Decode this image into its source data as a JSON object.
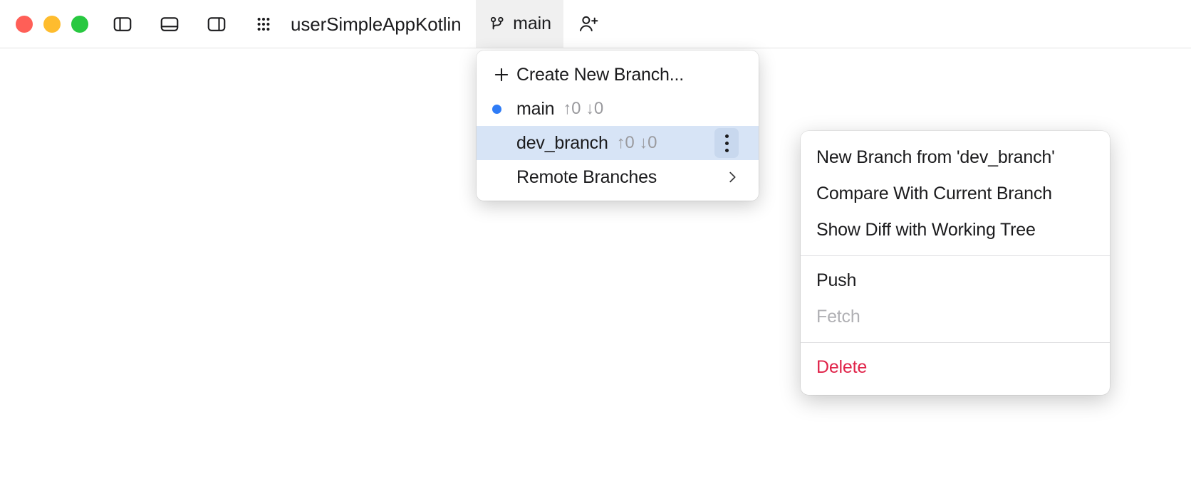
{
  "window": {
    "title": "userSimpleAppKotlin",
    "traffic_lights": [
      {
        "name": "close",
        "color": "#ff5f57"
      },
      {
        "name": "minimize",
        "color": "#febc2e"
      },
      {
        "name": "maximize",
        "color": "#28c840"
      }
    ],
    "toolbar_icons": [
      {
        "name": "left-panel-toggle-icon",
        "label": "Toggle Left Panel"
      },
      {
        "name": "bottom-panel-toggle-icon",
        "label": "Toggle Bottom Panel"
      },
      {
        "name": "right-panel-toggle-icon",
        "label": "Toggle Right Panel"
      },
      {
        "name": "grid-apps-icon",
        "label": "All Tools"
      }
    ],
    "branch_button": {
      "label": "main",
      "icon": "git-branch-icon",
      "active_background": "#f0f0f0"
    },
    "add_person_button": {
      "icon": "person-add-icon",
      "label": "Invite Collaborator"
    }
  },
  "branch_dropdown": {
    "items": [
      {
        "id": "create-new-branch",
        "label": "Create New Branch...",
        "icon": "plus-icon",
        "type": "action"
      },
      {
        "id": "main",
        "label": "main",
        "ahead": "↑0",
        "behind": "↓0",
        "type": "branch",
        "current": true,
        "bullet_color": "#2f7cf6"
      },
      {
        "id": "dev_branch",
        "label": "dev_branch",
        "ahead": "↑0",
        "behind": "↓0",
        "type": "branch",
        "current": false,
        "selected": true,
        "highlight_color": "#d7e4f6",
        "kebab_icon": "more-vertical-icon"
      },
      {
        "id": "remote-branches",
        "label": "Remote Branches",
        "type": "submenu",
        "chevron_icon": "chevron-right-icon"
      }
    ]
  },
  "context_menu": {
    "groups": [
      {
        "items": [
          {
            "id": "new-branch-from",
            "label": "New Branch from 'dev_branch'",
            "state": "enabled"
          },
          {
            "id": "compare-with-current-branch",
            "label": "Compare With Current Branch",
            "state": "enabled"
          },
          {
            "id": "show-diff-with-working-tree",
            "label": "Show Diff with Working Tree",
            "state": "enabled"
          }
        ]
      },
      {
        "items": [
          {
            "id": "push",
            "label": "Push",
            "state": "enabled"
          },
          {
            "id": "fetch",
            "label": "Fetch",
            "state": "disabled"
          }
        ]
      },
      {
        "items": [
          {
            "id": "delete",
            "label": "Delete",
            "state": "danger",
            "color": "#e0244a"
          }
        ]
      }
    ]
  }
}
